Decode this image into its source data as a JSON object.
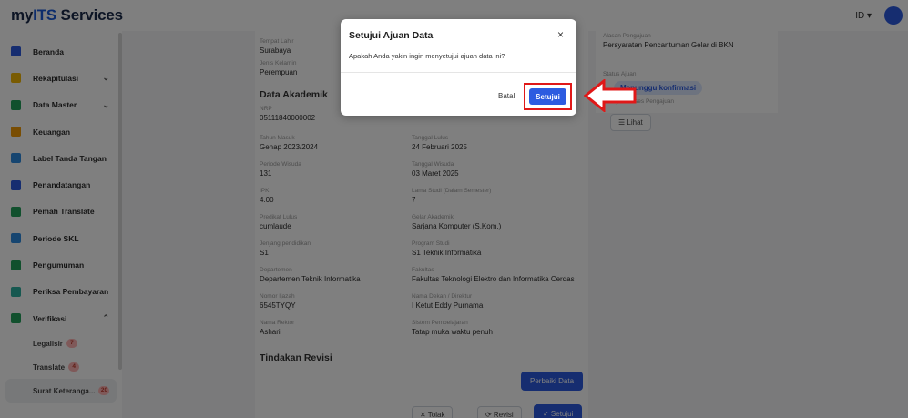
{
  "header": {
    "brand_prefix": "my",
    "brand_its": "ITS",
    "brand_suffix": " Services",
    "lang": "ID ▾"
  },
  "sidebar": {
    "items": [
      {
        "label": "Beranda",
        "color": "#2c5be0",
        "chev": ""
      },
      {
        "label": "Rekapitulasi",
        "color": "#f2b705",
        "chev": "⌄"
      },
      {
        "label": "Data Master",
        "color": "#22a05b",
        "chev": "⌄"
      },
      {
        "label": "Keuangan",
        "color": "#f29a05",
        "chev": ""
      },
      {
        "label": "Label Tanda Tangan",
        "color": "#2c8be0",
        "chev": ""
      },
      {
        "label": "Penandatangan",
        "color": "#2c5be0",
        "chev": ""
      },
      {
        "label": "Pemah Translate",
        "color": "#22a05b",
        "chev": ""
      },
      {
        "label": "Periode SKL",
        "color": "#2c8be0",
        "chev": ""
      },
      {
        "label": "Pengumuman",
        "color": "#22a05b",
        "chev": ""
      },
      {
        "label": "Periksa Pembayaran",
        "color": "#2cb0a0",
        "chev": ""
      },
      {
        "label": "Verifikasi",
        "color": "#22a05b",
        "chev": "⌃"
      }
    ],
    "subitems": [
      {
        "label": "Legalisir",
        "badge": "7"
      },
      {
        "label": "Translate",
        "badge": "4"
      },
      {
        "label": "Surat Keteranga...",
        "badge": "20"
      }
    ]
  },
  "main": {
    "fields": [
      {
        "label": "Tempat Lahir",
        "value": "Surabaya"
      },
      {
        "label": "Jenis Kelamin",
        "value": "Perempuan"
      },
      {
        "label": "NRP",
        "value": "05111840000002"
      },
      {
        "label": "Tahun Masuk",
        "value": "Genap 2023/2024"
      },
      {
        "label": "Tanggal Lulus",
        "value": "24 Februari 2025"
      },
      {
        "label": "Periode Wisuda",
        "value": "131"
      },
      {
        "label": "Tanggal Wisuda",
        "value": "03 Maret 2025"
      },
      {
        "label": "IPK",
        "value": "4.00"
      },
      {
        "label": "Lama Studi (Dalam Semester)",
        "value": "7"
      },
      {
        "label": "Predikat Lulus",
        "value": "cumlaude"
      },
      {
        "label": "Gelar Akademik",
        "value": "Sarjana Komputer (S.Kom.)"
      },
      {
        "label": "Jenjang pendidikan",
        "value": "S1"
      },
      {
        "label": "Program Studi",
        "value": "S1 Teknik Informatika"
      },
      {
        "label": "Departemen",
        "value": "Departemen Teknik Informatika"
      },
      {
        "label": "Fakultas",
        "value": "Fakultas Teknologi Elektro dan Informatika Cerdas"
      },
      {
        "label": "Nomor Ijazah",
        "value": "6545TYQY"
      },
      {
        "label": "Nama Dekan / Direktur",
        "value": "I Ketut Eddy Purnama"
      },
      {
        "label": "Nama Rektor",
        "value": "Ashari"
      },
      {
        "label": "Sistem Pembelajaran",
        "value": "Tatap muka waktu penuh"
      }
    ],
    "section_akademik": "Data Akademik",
    "section_revisi": "Tindakan Revisi",
    "btn_perbaiki": "Perbaiki Data",
    "btn_tolak": "✕ Tolak",
    "btn_revisi": "⟳ Revisi",
    "btn_setujui_bottom": "✓ Setujui",
    "right": {
      "alasan_label": "Alasan Pengajuan",
      "alasan_value": "Persyaratan Pencantuman Gelar di BKN",
      "status_label": "Status Ajuan",
      "status_value": "Menunggu konfirmasi",
      "riwayat_label": "Riwayat Proses Pengajuan",
      "lihat": "☰ Lihat"
    }
  },
  "modal": {
    "title": "Setujui Ajuan Data",
    "body": "Apakah Anda yakin ingin menyetujui ajuan data ini?",
    "close": "×",
    "cancel_label": "Batal",
    "confirm_label": "Setujui"
  },
  "colors": {
    "accent": "#2c5be0",
    "highlight": "#e01818"
  }
}
